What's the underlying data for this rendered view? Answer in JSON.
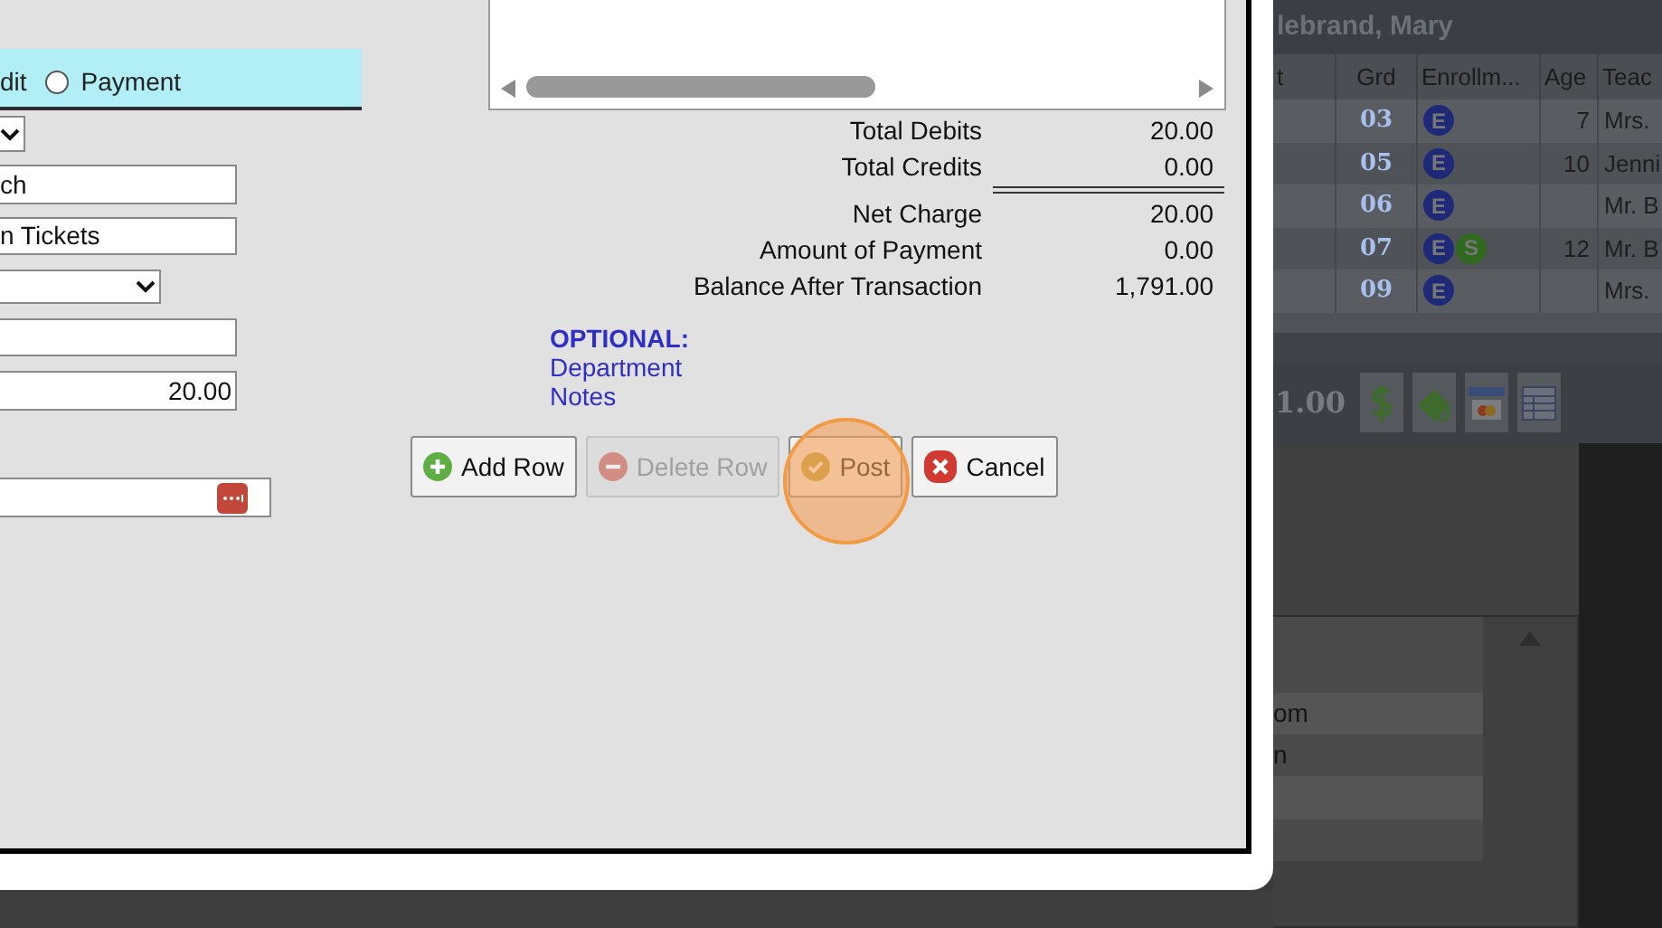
{
  "dialog": {
    "type_header": {
      "cut_label": "dit",
      "options": [
        {
          "label": "Payment",
          "selected": false
        }
      ]
    },
    "fields": [
      {
        "kind": "select"
      },
      {
        "kind": "text",
        "value": "ch"
      },
      {
        "kind": "text",
        "value": "n Tickets"
      },
      {
        "kind": "select"
      },
      {
        "kind": "text"
      },
      {
        "kind": "amount",
        "value": "20.00"
      },
      {
        "kind": "lookup"
      }
    ],
    "totals": [
      {
        "label": "Total Debits",
        "value": "20.00",
        "rule_after": false
      },
      {
        "label": "Total Credits",
        "value": "0.00",
        "rule_after": true
      },
      {
        "label": "Net Charge",
        "value": "20.00",
        "rule_after": false
      },
      {
        "label": "Amount of Payment",
        "value": "0.00",
        "rule_after": false
      },
      {
        "label": "Balance After Transaction",
        "value": "1,791.00",
        "rule_after": false
      }
    ],
    "optional": {
      "title": "OPTIONAL:",
      "links": [
        "Department",
        "Notes"
      ]
    },
    "buttons": [
      {
        "label": "Add Row",
        "kind": "add",
        "disabled": false,
        "highlighted": false
      },
      {
        "label": "Delete Row",
        "kind": "delete",
        "disabled": true,
        "highlighted": false
      },
      {
        "label": "Post",
        "kind": "post",
        "disabled": false,
        "highlighted": true
      },
      {
        "label": "Cancel",
        "kind": "cancel",
        "disabled": false,
        "highlighted": false
      }
    ]
  },
  "background_app": {
    "student_name": "lebrand, Mary",
    "table": {
      "columns": [
        "t",
        "Grd",
        "Enrollm...",
        "Age",
        "Teac"
      ],
      "rows": [
        {
          "grade": "03",
          "badges": [
            {
              "letter": "E",
              "color": "#1e2a78"
            }
          ],
          "age": "7",
          "teacher": "Mrs."
        },
        {
          "grade": "05",
          "badges": [
            {
              "letter": "E",
              "color": "#1e2a78"
            }
          ],
          "age": "10",
          "teacher": "Jenni"
        },
        {
          "grade": "06",
          "badges": [
            {
              "letter": "E",
              "color": "#1e2a78"
            }
          ],
          "teacher": "Mr. B"
        },
        {
          "grade": "07",
          "badges": [
            {
              "letter": "E",
              "color": "#1e2a78"
            },
            {
              "letter": "S",
              "color": "#2f6a1e"
            }
          ],
          "age": "12",
          "teacher": "Mr. B"
        },
        {
          "grade": "09",
          "badges": [
            {
              "letter": "E",
              "color": "#1e2a78"
            }
          ],
          "teacher": "Mrs."
        }
      ]
    },
    "toolbar": {
      "amount": "1.00",
      "buttons": [
        {
          "kind": "dollar"
        },
        {
          "kind": "money"
        },
        {
          "kind": "card"
        },
        {
          "kind": "table"
        }
      ]
    },
    "list": {
      "cells": [
        "om",
        "n"
      ]
    }
  }
}
